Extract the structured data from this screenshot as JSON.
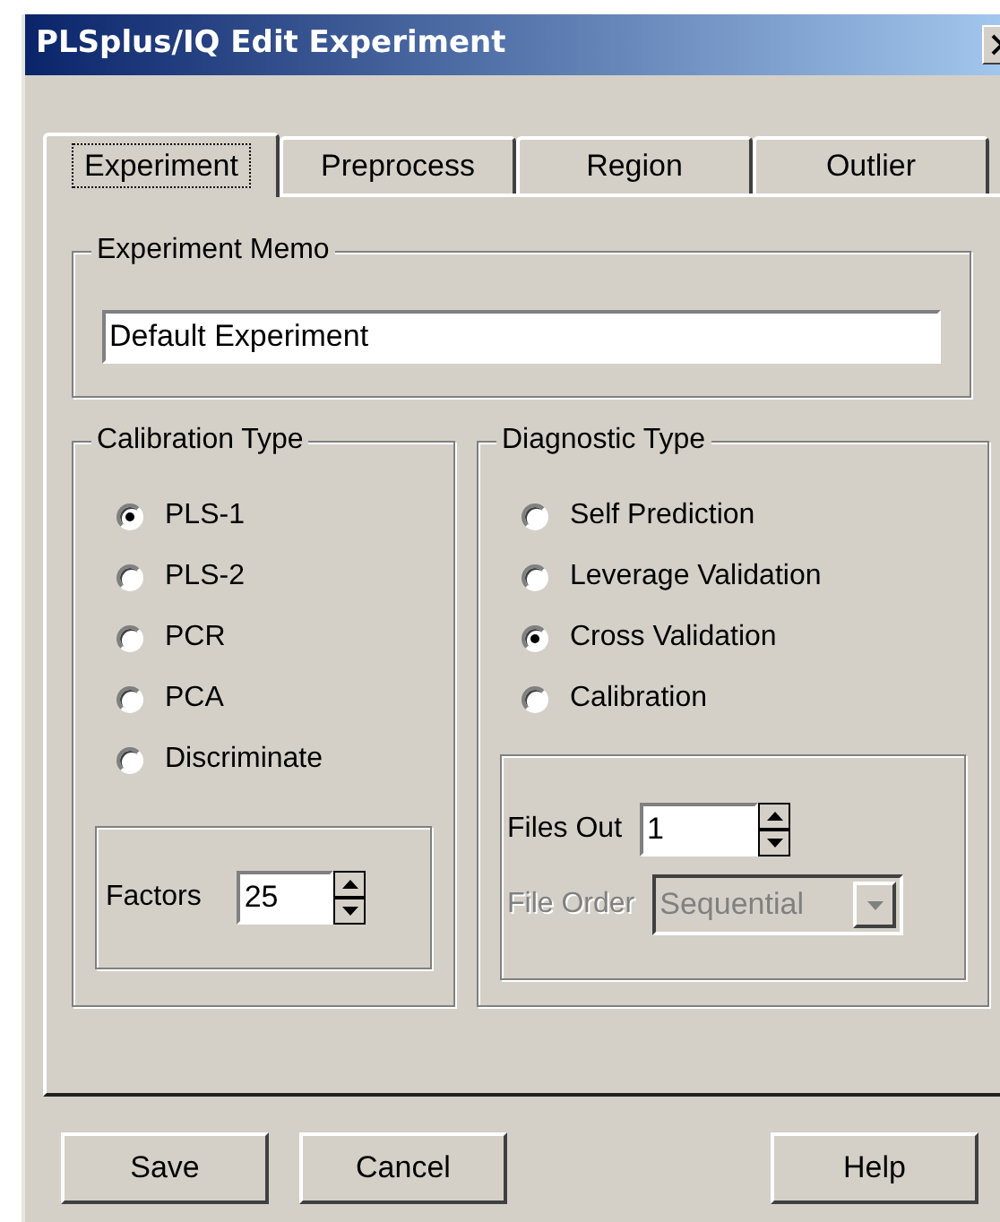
{
  "window": {
    "title": "PLSplus/IQ Edit Experiment"
  },
  "tabs": [
    {
      "label": "Experiment",
      "selected": true
    },
    {
      "label": "Preprocess",
      "selected": false
    },
    {
      "label": "Region",
      "selected": false
    },
    {
      "label": "Outlier",
      "selected": false
    }
  ],
  "experiment_memo": {
    "title": "Experiment Memo",
    "value": "Default Experiment"
  },
  "calibration_type": {
    "title": "Calibration Type",
    "options": [
      {
        "label": "PLS-1",
        "selected": true
      },
      {
        "label": "PLS-2",
        "selected": false
      },
      {
        "label": "PCR",
        "selected": false
      },
      {
        "label": "PCA",
        "selected": false
      },
      {
        "label": "Discriminate",
        "selected": false
      }
    ],
    "factors": {
      "label": "Factors",
      "value": "25"
    }
  },
  "diagnostic_type": {
    "title": "Diagnostic Type",
    "options": [
      {
        "label": "Self Prediction",
        "selected": false
      },
      {
        "label": "Leverage Validation",
        "selected": false
      },
      {
        "label": "Cross Validation",
        "selected": true
      },
      {
        "label": "Calibration",
        "selected": false
      }
    ],
    "files_out": {
      "label": "Files Out",
      "value": "1"
    },
    "file_order": {
      "label": "File Order",
      "value": "Sequential",
      "disabled": true
    }
  },
  "buttons": [
    "Save",
    "Cancel",
    "Help"
  ]
}
